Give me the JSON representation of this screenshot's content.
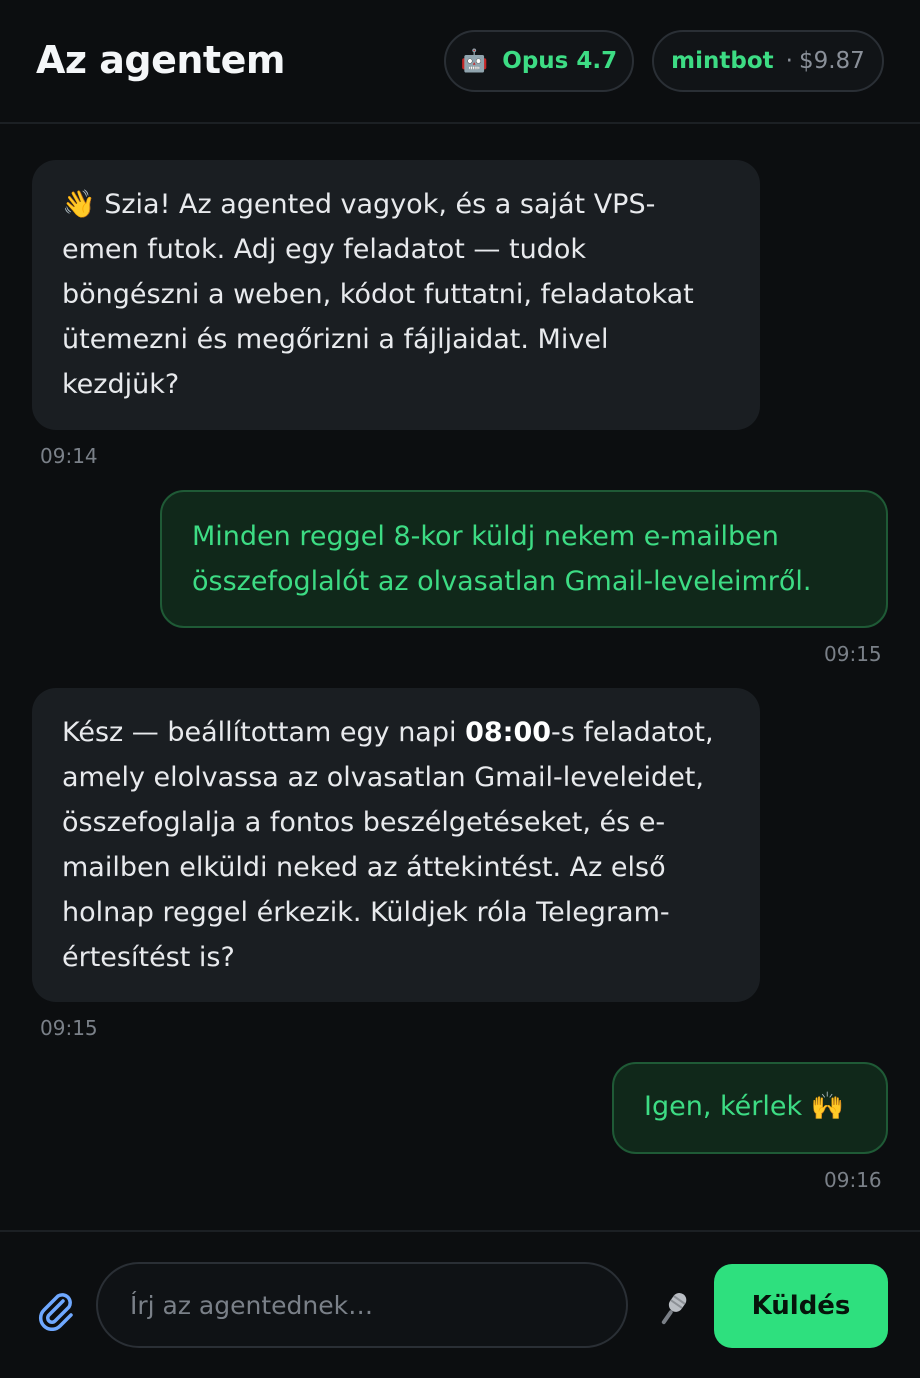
{
  "header": {
    "title": "Az agentem",
    "model_icon": "🤖",
    "model_label": "Opus 4.7",
    "user_name": "mintbot",
    "separator": "·",
    "balance": "$9.87"
  },
  "messages": [
    {
      "role": "agent",
      "emoji": "👋",
      "text": "Szia! Az agented vagyok, és a saját VPS-emen futok. Adj egy feladatot — tudok böngészni a weben, kódot futtatni, feladatokat ütemezni és megőrizni a fájljaidat. Mivel kezdjük?",
      "time": "09:14"
    },
    {
      "role": "user",
      "text": "Minden reggel 8-kor küldj nekem e-mailben összefoglalót az olvasatlan Gmail-leveleimről.",
      "time": "09:15"
    },
    {
      "role": "agent",
      "text_before": "Kész — beállítottam egy napi ",
      "text_bold": "08:00",
      "text_after": "-s feladatot, amely elolvassa az olvasatlan Gmail-leveleidet, összefoglalja a fontos beszélgetéseket, és e-mailben elküldi neked az áttekintést. Az első holnap reggel érkezik. Küldjek róla Telegram-értesítést is?",
      "time": "09:15"
    },
    {
      "role": "user",
      "text": "Igen, kérlek",
      "emoji": "🙌",
      "time": "09:16"
    }
  ],
  "composer": {
    "attach_icon": "paperclip-icon",
    "placeholder": "Írj az agentednek…",
    "mic_icon": "microphone-icon",
    "send_label": "Küldés"
  },
  "colors": {
    "accent": "#3ddc84",
    "send_bg": "#2ee07e",
    "background": "#0c0e10",
    "agent_bubble": "#1a1e22",
    "user_bubble": "#10281a"
  }
}
